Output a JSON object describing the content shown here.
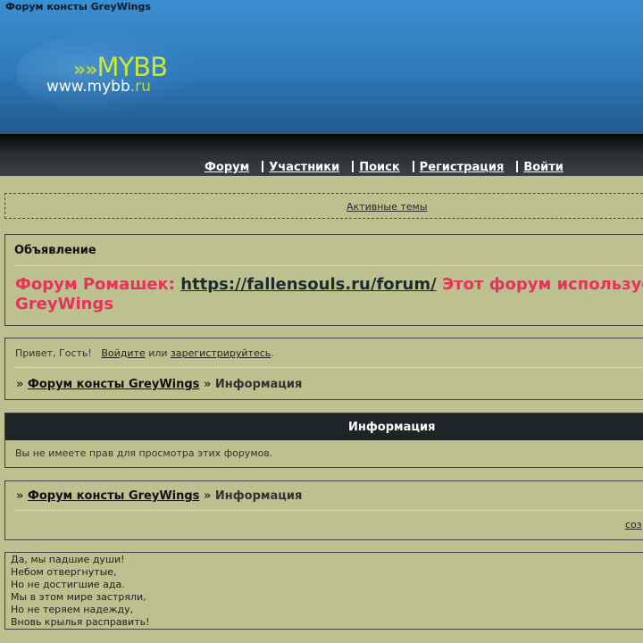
{
  "site": {
    "title": "Форум консты GreyWings",
    "logo": {
      "arrows": "»",
      "name": "MYBB",
      "url_main": "www.mybb",
      "url_tld": ".ru"
    }
  },
  "nav": {
    "items": [
      "Форум",
      "Участники",
      "Поиск",
      "Регистрация",
      "Войти"
    ]
  },
  "active_topics": "Активные темы",
  "announcement": {
    "title": "Объявление",
    "lead": "Форум Ромашек: ",
    "link": "https://fallensouls.ru/forum/",
    "tail": " Этот форум использует",
    "line2": "GreyWings"
  },
  "welcome": {
    "greeting": "Привет, Гость!",
    "login": "Войдите",
    "or": "или",
    "register": "зарегистрируйтесь",
    "period": "."
  },
  "breadcrumb": {
    "sep": "»",
    "forum": "Форум консты GreyWings",
    "current": "Информация"
  },
  "info": {
    "title": "Информация",
    "message": "Вы не имеете прав для просмотра этих форумов."
  },
  "footer_link": "соз",
  "poem": [
    "Да, мы падшие души!",
    "Небом отвергнутые,",
    "Но не достигшие ада.",
    "Мы в этом мире застряли,",
    "Но не теряем надежду,",
    "Вновь крылья расправить!"
  ],
  "colors": {
    "page_bg": "#bdc08f",
    "header_blue": "#2f78b8",
    "announcement_red": "#e8325c",
    "info_header": "#1d2527"
  }
}
